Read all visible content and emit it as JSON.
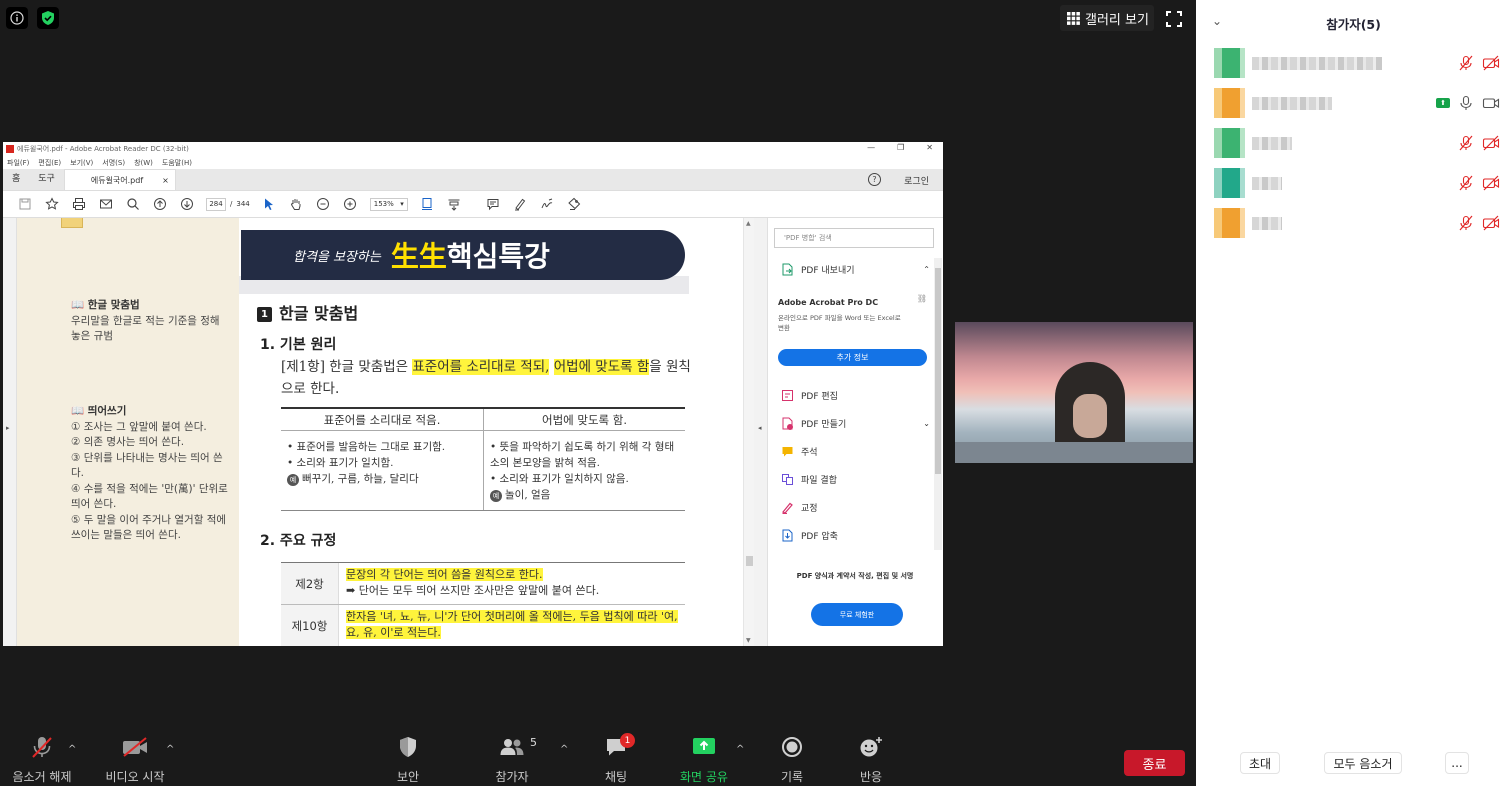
{
  "top_bar": {
    "gallery_label": "갤러리 보기"
  },
  "acrobat": {
    "window_title": "에듀윌국어.pdf - Adobe Acrobat Reader DC (32-bit)",
    "menu": [
      "파일(F)",
      "편집(E)",
      "보기(V)",
      "서명(S)",
      "창(W)",
      "도움말(H)"
    ],
    "tabs": {
      "home": "홈",
      "tools": "도구",
      "doc": "에듀윌국어.pdf",
      "close": "×"
    },
    "help_icon": "?",
    "login": "로그인",
    "page_current": "284",
    "page_sep": "/",
    "page_total": "344",
    "zoom": "153%",
    "side": {
      "h1": "한글 맞춤법",
      "d1": "우리말을 한글로 적는 기준을 정해 놓은 규범",
      "h2": "띄어쓰기",
      "items": [
        "① 조사는 그 앞말에 붙여 쓴다.",
        "② 의존 명사는 띄어 쓴다.",
        "③ 단위를 나타내는 명사는 띄어 쓴다.",
        "④ 수를 적을 적에는 '만(萬)' 단위로 띄어 쓴다.",
        "⑤ 두 말을 이어 주거나 열거할 적에 쓰이는 말들은 띄어 쓴다."
      ]
    },
    "banner": {
      "cursive": "합격을 보장하는",
      "yellow": "生生",
      "white": "핵심특강"
    },
    "section1": {
      "num": "1",
      "title": "한글 맞춤법"
    },
    "sub1": "1. 기본 원리",
    "para1": {
      "prefix": "[제1항] 한글 맞춤법은 ",
      "hl1": "표준어를 소리대로 적되,",
      "mid": " ",
      "hl2": "어법에 맞도록 함",
      "suffix": "을 원칙으로 한다."
    },
    "rule_table": {
      "col1_head": "표준어를 소리대로 적음.",
      "col1_lines": [
        "• 표준어를 발음하는 그대로 표기함.",
        "• 소리와 표기가 일치함."
      ],
      "col1_ex": "뻐꾸기, 구름, 하늘, 달리다",
      "col2_head": "어법에 맞도록 함.",
      "col2_lines": [
        "• 뜻을 파악하기 쉽도록 하기 위해 각 형태소의 본모양을 밝혀 적음.",
        "• 소리와 표기가 일치하지 않음."
      ],
      "col2_ex": "놀이, 얼음",
      "ex_mark": "예"
    },
    "sub2": "2. 주요 규정",
    "articles": [
      {
        "num": "제2항",
        "hl": "문장의 각 단어는 띄어 씀을 원칙으로 한다.",
        "note": "➡ 단어는 모두 띄어 쓰지만 조사만은 앞말에 붙여 쓴다."
      },
      {
        "num": "제10항",
        "hl": "한자음 '녀, 뇨, 뉴, 니'가 단어 첫머리에 올 적에는, 두음 법칙에 따라 '여, 요, 유, 이'로 적는다.",
        "note": ""
      }
    ],
    "tools_panel": {
      "search_placeholder": "'PDF 병합' 검색",
      "export": "PDF 내보내기",
      "promo_title": "Adobe Acrobat Pro DC",
      "promo_desc": "온라인으로 PDF 파일을 Word 또는 Excel로 변환",
      "promo_btn": "추가 정보",
      "items": [
        "PDF 편집",
        "PDF 만들기",
        "주석",
        "파일 결합",
        "교정",
        "PDF 압축"
      ],
      "trial_desc": "PDF 양식과 계약서 작성, 편집 및 서명",
      "trial_btn": "무료 체험판"
    }
  },
  "bottom_bar": {
    "mute": "음소거 해제",
    "video": "비디오 시작",
    "security": "보안",
    "participants": "참가자",
    "participants_count": "5",
    "chat": "채팅",
    "chat_badge": "1",
    "share": "화면 공유",
    "record": "기록",
    "reactions": "반응",
    "end": "종료"
  },
  "panel": {
    "title": "참가자(5)",
    "invite": "초대",
    "mute_all": "모두 음소거",
    "more": "...",
    "participants": [
      {
        "avatar_color": "#3cb371",
        "mic": "muted",
        "video": "off",
        "sharing": false
      },
      {
        "avatar_color": "#f0a030",
        "mic": "on",
        "video": "on",
        "sharing": true
      },
      {
        "avatar_color": "#3cb371",
        "mic": "muted",
        "video": "off",
        "sharing": false
      },
      {
        "avatar_color": "#22a88a",
        "mic": "muted",
        "video": "off",
        "sharing": false
      },
      {
        "avatar_color": "#f0a030",
        "mic": "muted",
        "video": "off",
        "sharing": false
      }
    ]
  },
  "colors": {
    "end_red": "#c8182a",
    "share_green": "#16a34a",
    "acrobat_blue": "#1473e6",
    "highlight": "#fff43c",
    "muted_red": "#e02828"
  }
}
